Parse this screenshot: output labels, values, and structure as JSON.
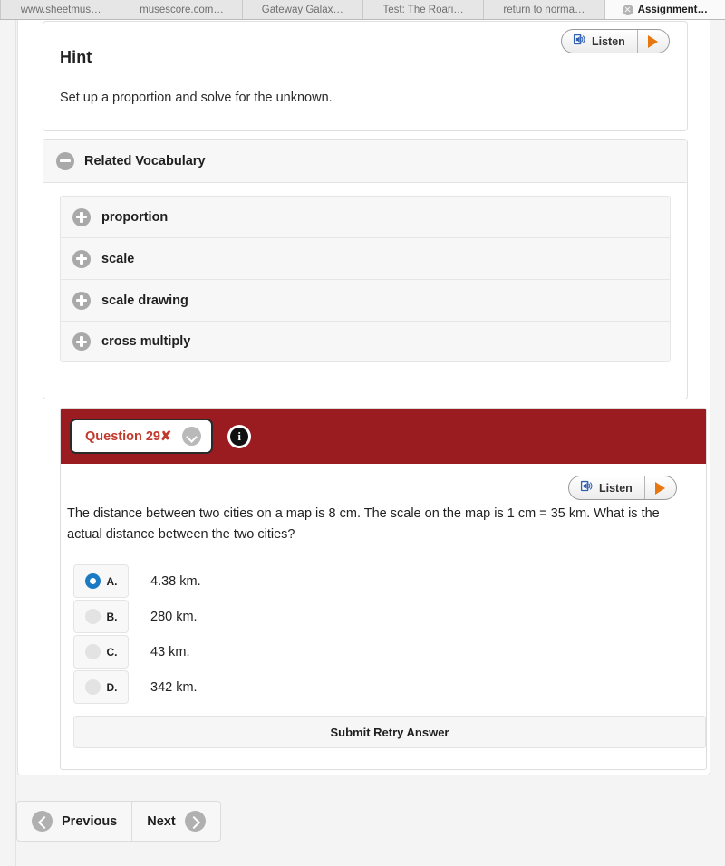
{
  "browser": {
    "tabs": [
      {
        "label": "www.sheetmus…",
        "active": false,
        "closable": false
      },
      {
        "label": "musescore.com…",
        "active": false,
        "closable": false
      },
      {
        "label": "Gateway Galax…",
        "active": false,
        "closable": false
      },
      {
        "label": "Test: The Roari…",
        "active": false,
        "closable": false
      },
      {
        "label": "return to norma…",
        "active": false,
        "closable": false
      },
      {
        "label": "Assignment…",
        "active": true,
        "closable": true
      }
    ]
  },
  "hint": {
    "title": "Hint",
    "body": "Set up a proportion and solve for the unknown.",
    "listen_label": "Listen"
  },
  "vocabulary": {
    "title": "Related Vocabulary",
    "collapse_state": "expanded",
    "items": [
      {
        "label": "proportion"
      },
      {
        "label": "scale"
      },
      {
        "label": "scale drawing"
      },
      {
        "label": "cross multiply"
      }
    ]
  },
  "question": {
    "pill_label": "Question 29",
    "pill_mark": "✘",
    "header_color": "#9b1c20",
    "pill_text_color": "#c0392b",
    "listen_label": "Listen",
    "text": "The distance between two cities on a map is 8 cm. The scale on the map is 1 cm = 35 km. What is the actual distance between the two cities?",
    "choices": [
      {
        "letter": "A.",
        "text": "4.38 km.",
        "selected": true
      },
      {
        "letter": "B.",
        "text": "280 km.",
        "selected": false
      },
      {
        "letter": "C.",
        "text": "43 km.",
        "selected": false
      },
      {
        "letter": "D.",
        "text": "342 km.",
        "selected": false
      }
    ],
    "selected_color": "#1a7ac4",
    "submit_label": "Submit Retry Answer"
  },
  "navigation": {
    "previous_label": "Previous",
    "next_label": "Next"
  }
}
